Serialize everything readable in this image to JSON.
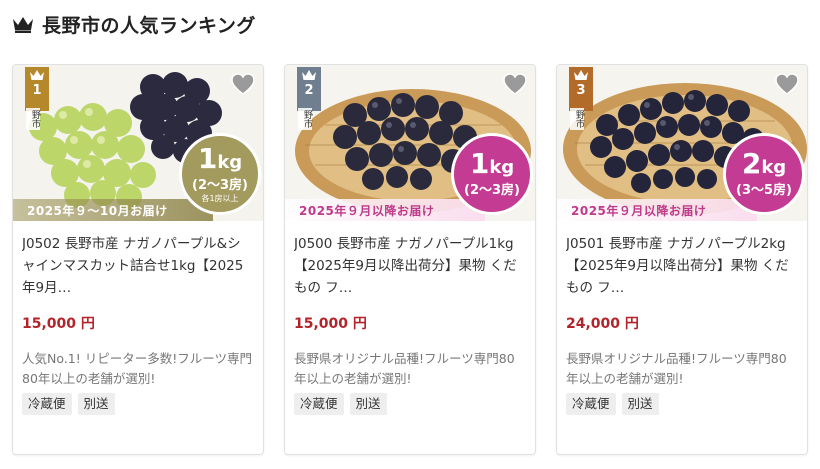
{
  "header": {
    "title": "長野市の人気ランキング",
    "icon": "crown-icon"
  },
  "products": [
    {
      "rank": "1",
      "rank_color": "#b5892b",
      "city_tag": "野市",
      "ship_label": "2025年９～10月お届け",
      "weight": "1",
      "weight_unit": "kg",
      "sub": "(2～3房)",
      "note": "各1房以上",
      "title": "J0502 長野市産 ナガノパープル&シャインマスカット詰合せ1kg【2025年9月…",
      "price": "15,000 円",
      "desc": "人気No.1! リピーター多数!フルーツ専門80年以上の老舗が選別!",
      "tags": [
        "冷蔵便",
        "別送"
      ]
    },
    {
      "rank": "2",
      "rank_color": "#6f7f8f",
      "city_tag": "野市",
      "ship_label": "2025年９月以降お届け",
      "weight": "1",
      "weight_unit": "kg",
      "sub": "(2～3房)",
      "note": "",
      "title": "J0500 長野市産 ナガノパープル1kg【2025年9月以降出荷分】果物 くだもの フ…",
      "price": "15,000 円",
      "desc": "長野県オリジナル品種!フルーツ専門80年以上の老舗が選別!",
      "tags": [
        "冷蔵便",
        "別送"
      ]
    },
    {
      "rank": "3",
      "rank_color": "#b36b2a",
      "city_tag": "野市",
      "ship_label": "2025年９月以降お届け",
      "weight": "2",
      "weight_unit": "kg",
      "sub": "(3～5房)",
      "note": "",
      "title": "J0501 長野市産 ナガノパープル2kg【2025年9月以降出荷分】果物 くだもの フ…",
      "price": "24,000 円",
      "desc": "長野県オリジナル品種!フルーツ専門80年以上の老舗が選別!",
      "tags": [
        "冷蔵便",
        "別送"
      ]
    }
  ]
}
